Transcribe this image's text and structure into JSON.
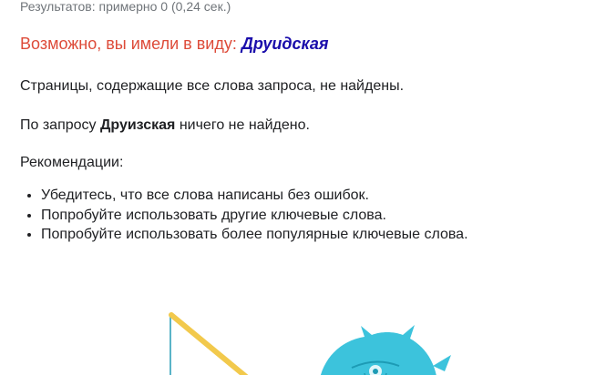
{
  "results_stats": "Результатов: примерно 0 (0,24 сек.)",
  "suggestion": {
    "prefix": "Возможно, вы имели в виду: ",
    "term": "Друидская"
  },
  "not_found_all_words": "Страницы, содержащие все слова запроса, не найдены.",
  "query_result": {
    "before": "По запросу ",
    "query": "Друизская",
    "after": " ничего не найдено."
  },
  "recommendations": {
    "heading": "Рекомендации:",
    "items": [
      "Убедитесь, что все слова написаны без ошибок.",
      "Попробуйте использовать другие ключевые слова.",
      "Попробуйте использовать более популярные ключевые слова."
    ]
  },
  "illustration": {
    "icon": "fishing-monster-illustration",
    "colors": {
      "rod": "#f2c94c",
      "line": "#5ab4c8",
      "creature": "#3cc3dc",
      "creature_dark": "#1d9bb5"
    }
  }
}
